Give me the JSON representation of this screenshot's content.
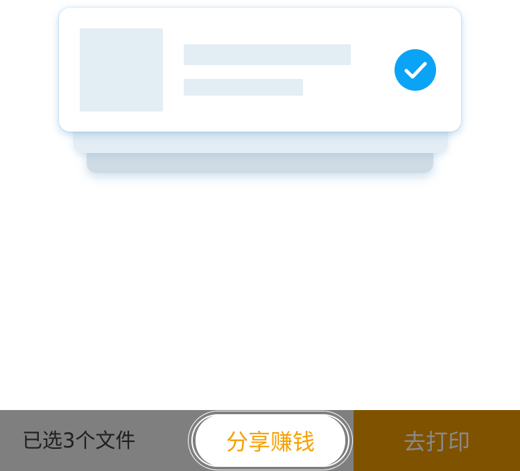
{
  "bottom_bar": {
    "selected_text": "已选3个文件",
    "share_label": "分享赚钱",
    "print_label": "去打印"
  },
  "card": {
    "icons": {
      "check": "check-circle-icon"
    }
  },
  "colors": {
    "accent_blue": "#0aa3f5",
    "share_text": "#f5a000",
    "print_bg": "#7f5200",
    "bar_bg": "#7f7f7f",
    "placeholder": "#e3edf4"
  }
}
